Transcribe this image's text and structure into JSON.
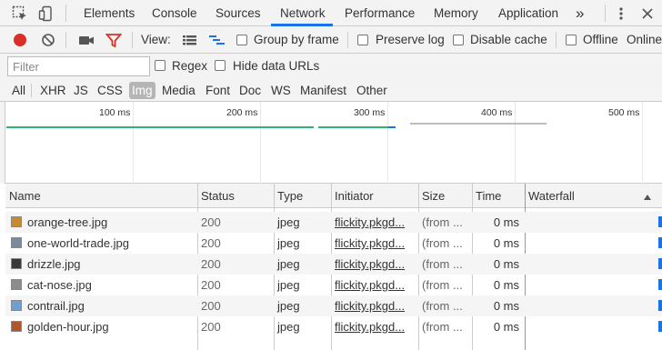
{
  "tabs": {
    "items": [
      "Elements",
      "Console",
      "Sources",
      "Network",
      "Performance",
      "Memory",
      "Application"
    ],
    "active": "Network",
    "overflow": "»"
  },
  "toolbar": {
    "view_label": "View:",
    "group_by_frame": "Group by frame",
    "preserve_log": "Preserve log",
    "disable_cache": "Disable cache",
    "offline": "Offline",
    "online": "Online"
  },
  "filter": {
    "placeholder": "Filter",
    "regex": "Regex",
    "hide_data_urls": "Hide data URLs"
  },
  "types": {
    "items": [
      "All",
      "XHR",
      "JS",
      "CSS",
      "Img",
      "Media",
      "Font",
      "Doc",
      "WS",
      "Manifest",
      "Other"
    ],
    "active": "Img"
  },
  "overview": {
    "ticks": [
      "100 ms",
      "200 ms",
      "300 ms",
      "400 ms",
      "500 ms"
    ]
  },
  "table": {
    "columns": [
      "Name",
      "Status",
      "Type",
      "Initiator",
      "Size",
      "Time",
      "Waterfall"
    ],
    "rows": [
      {
        "name": "orange-tree.jpg",
        "status": "200",
        "type": "jpeg",
        "initiator": "flickity.pkgd...",
        "size": "(from ...",
        "time": "0 ms"
      },
      {
        "name": "one-world-trade.jpg",
        "status": "200",
        "type": "jpeg",
        "initiator": "flickity.pkgd...",
        "size": "(from ...",
        "time": "0 ms"
      },
      {
        "name": "drizzle.jpg",
        "status": "200",
        "type": "jpeg",
        "initiator": "flickity.pkgd...",
        "size": "(from ...",
        "time": "0 ms"
      },
      {
        "name": "cat-nose.jpg",
        "status": "200",
        "type": "jpeg",
        "initiator": "flickity.pkgd...",
        "size": "(from ...",
        "time": "0 ms"
      },
      {
        "name": "contrail.jpg",
        "status": "200",
        "type": "jpeg",
        "initiator": "flickity.pkgd...",
        "size": "(from ...",
        "time": "0 ms"
      },
      {
        "name": "golden-hour.jpg",
        "status": "200",
        "type": "jpeg",
        "initiator": "flickity.pkgd...",
        "size": "(from ...",
        "time": "0 ms"
      }
    ]
  },
  "colors": {
    "accent": "#1a73e8",
    "record": "#d93025",
    "filter_icon": "#d93025",
    "bar_green": "#2bb673",
    "bar_gray": "#bdbdbd"
  }
}
